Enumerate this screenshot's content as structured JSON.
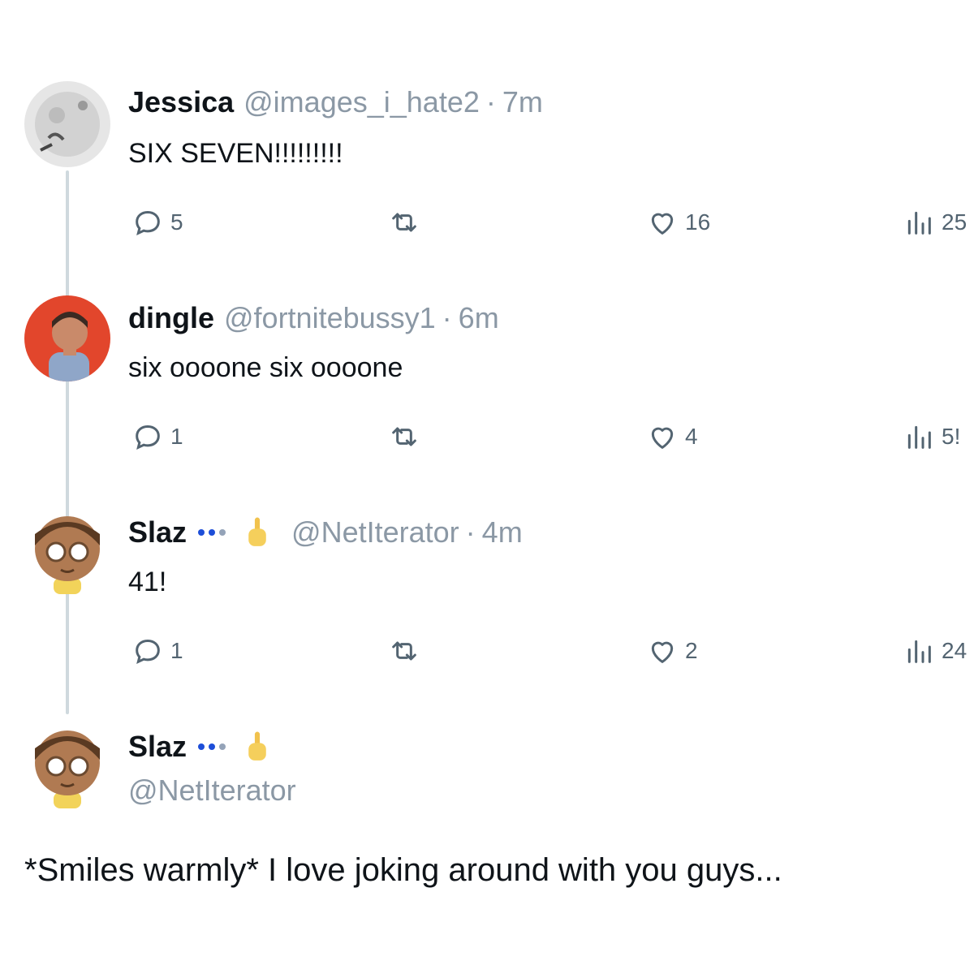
{
  "tweets": [
    {
      "name": "Jessica",
      "handle": "@images_i_hate2",
      "time": "7m",
      "text": "SIX SEVEN!!!!!!!!!",
      "replies": "5",
      "retweets": "",
      "likes": "16",
      "views": "25"
    },
    {
      "name": "dingle",
      "handle": "@fortnitebussy1",
      "time": "6m",
      "text": "six oooone six oooone",
      "replies": "1",
      "retweets": "",
      "likes": "4",
      "views": "5!"
    },
    {
      "name": "Slaz",
      "handle": "@NetIterator",
      "time": "4m",
      "text": "41!",
      "replies": "1",
      "retweets": "",
      "likes": "2",
      "views": "24"
    }
  ],
  "final": {
    "name": "Slaz",
    "handle": "@NetIterator",
    "text": "*Smiles warmly* I love joking around with you guys..."
  },
  "separator": "·",
  "colors": {
    "muted": "#8b98a5",
    "icon": "#536471",
    "line": "#cfd9de",
    "text": "#0f1419"
  },
  "icons": [
    "reply-icon",
    "retweet-icon",
    "like-icon",
    "views-icon",
    "pointing-hand-icon"
  ]
}
